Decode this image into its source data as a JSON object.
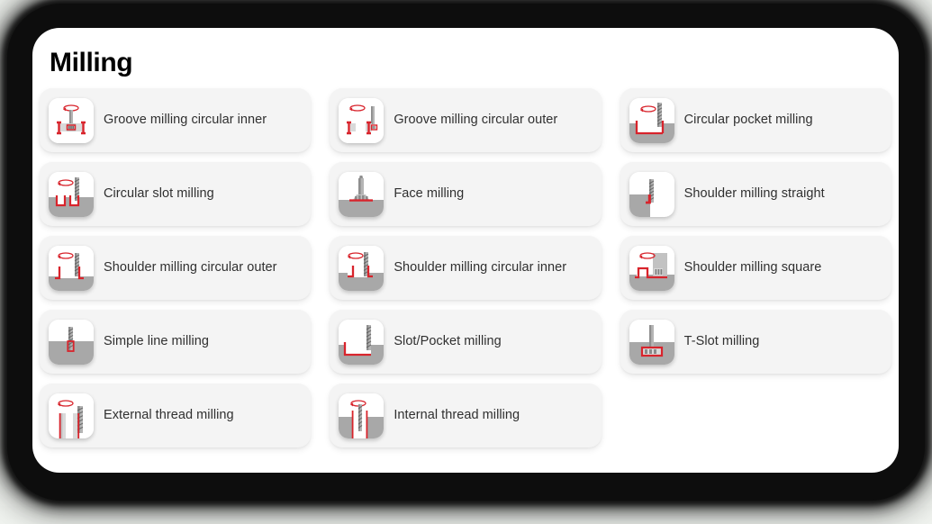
{
  "page": {
    "title": "Milling",
    "accent_red": "#d8242c",
    "panel_background": "#ffffff",
    "card_background": "#f4f4f4",
    "frame_color": "#0d0d0d",
    "outer_background": "#f3f6f2"
  },
  "operations": [
    {
      "label": "Groove milling circular inner",
      "icon": "groove-milling-circular-inner-icon"
    },
    {
      "label": "Groove milling circular outer",
      "icon": "groove-milling-circular-outer-icon"
    },
    {
      "label": "Circular pocket milling",
      "icon": "circular-pocket-milling-icon"
    },
    {
      "label": "Circular slot milling",
      "icon": "circular-slot-milling-icon"
    },
    {
      "label": "Face milling",
      "icon": "face-milling-icon"
    },
    {
      "label": "Shoulder milling straight",
      "icon": "shoulder-milling-straight-icon"
    },
    {
      "label": "Shoulder milling circular outer",
      "icon": "shoulder-milling-circular-outer-icon"
    },
    {
      "label": "Shoulder milling circular inner",
      "icon": "shoulder-milling-circular-inner-icon"
    },
    {
      "label": "Shoulder milling square",
      "icon": "shoulder-milling-square-icon"
    },
    {
      "label": "Simple line milling",
      "icon": "simple-line-milling-icon"
    },
    {
      "label": "Slot/Pocket milling",
      "icon": "slot-pocket-milling-icon"
    },
    {
      "label": "T-Slot milling",
      "icon": "t-slot-milling-icon"
    },
    {
      "label": "External thread milling",
      "icon": "external-thread-milling-icon"
    },
    {
      "label": "Internal thread milling",
      "icon": "internal-thread-milling-icon"
    }
  ]
}
